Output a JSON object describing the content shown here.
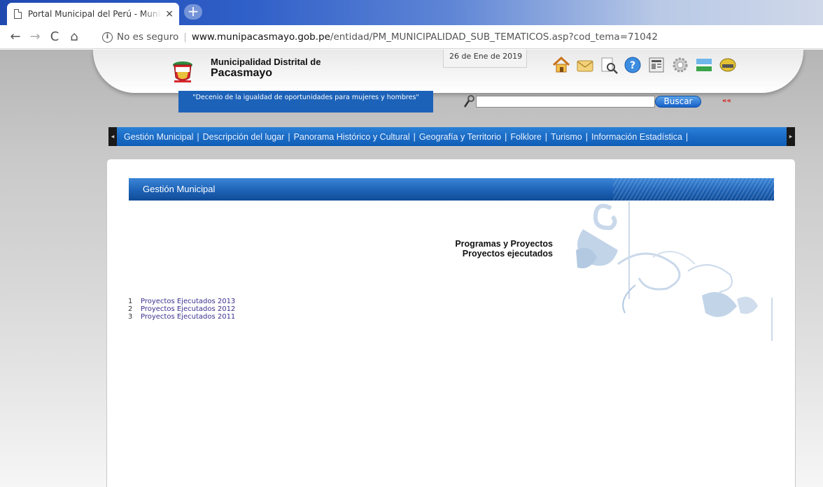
{
  "browser": {
    "tab_title": "Portal Municipal del Perú - Munic",
    "tab_close": "×",
    "new_tab": "+",
    "security_label": "No es seguro",
    "url_separator": "|",
    "url_host": "www.munipacasmayo.gob.pe",
    "url_path": "/entidad/PM_MUNICIPALIDAD_SUB_TEMATICOS.asp?cod_tema=71042",
    "back_icon": "back-arrow-icon",
    "forward_icon": "forward-arrow-icon",
    "reload_icon": "reload-icon",
    "home_icon": "home-icon",
    "bookmark_icon": "star-icon"
  },
  "header": {
    "name_line1": "Municipalidad Distrital de",
    "name_line2": "Pacasmayo",
    "date": "26 de Ene de 2019",
    "slogan": "\"Decenio de la igualdad de oportunidades para mujeres y hombres\"",
    "icons": [
      "home-icon",
      "mail-icon",
      "search-doc-icon",
      "help-icon",
      "news-icon",
      "gear-icon",
      "landscape-icon",
      "chat-icon"
    ]
  },
  "search": {
    "value": "",
    "button_label": "Buscar",
    "arrow_link": "««"
  },
  "menu": {
    "left_cap": "◂",
    "right_cap": "▸",
    "separator": "|",
    "items": [
      "Gestión Municipal",
      "Descripción del lugar",
      "Panorama Histórico y Cultural",
      "Geografía y Territorio",
      "Folklore",
      "Turismo",
      "Información Estadística"
    ]
  },
  "section": {
    "title": "Gestión Municipal",
    "heading_line1": "Programas y Proyectos",
    "heading_line2": "Proyectos ejecutados"
  },
  "projects": [
    {
      "num": "1",
      "label": "Proyectos Ejecutados 2013"
    },
    {
      "num": "2",
      "label": "Proyectos Ejecutados 2012"
    },
    {
      "num": "3",
      "label": "Proyectos Ejecutados 2011"
    }
  ],
  "colors": {
    "accent_blue": "#1c62b8",
    "link_purple": "#3a2f8f",
    "arrow_red": "#d42020"
  }
}
